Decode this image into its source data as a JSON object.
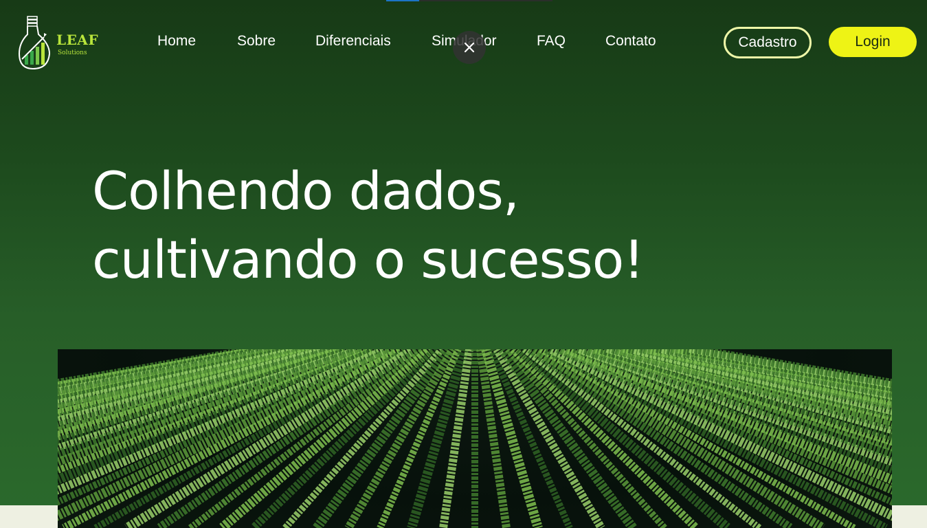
{
  "brand": {
    "name": "LEAF",
    "tagline": "Solutions"
  },
  "nav": {
    "items": [
      {
        "label": "Home"
      },
      {
        "label": "Sobre"
      },
      {
        "label": "Diferenciais"
      },
      {
        "label": "Simulador"
      },
      {
        "label": "FAQ"
      },
      {
        "label": "Contato"
      }
    ]
  },
  "auth": {
    "signup_label": "Cadastro",
    "login_label": "Login"
  },
  "overlay": {
    "close_icon": "close-icon"
  },
  "hero": {
    "line1": "Colhendo dados,",
    "line2": "cultivando o sucesso!",
    "image": "crop-field-rows"
  },
  "colors": {
    "accent_yellow": "#eef315",
    "brand_green": "#b9e53b",
    "background_dark_green": "#1d4a1d",
    "cadastro_border": "#eef7a8"
  }
}
